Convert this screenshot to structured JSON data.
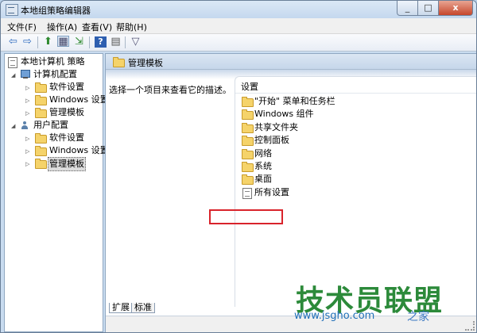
{
  "window": {
    "title": "本地组策略编辑器",
    "minimize": "_",
    "maximize": "□",
    "close": "x"
  },
  "menu": {
    "file": "文件(F)",
    "action": "操作(A)",
    "view": "查看(V)",
    "help": "帮助(H)"
  },
  "toolbar": {
    "icons": [
      "back-arrow",
      "forward-arrow",
      "up-folder",
      "show-tree",
      "export-list",
      "help",
      "properties",
      "filter"
    ],
    "glyphs": {
      "back": "⇦",
      "forward": "⇨",
      "up": "⬆",
      "tree": "▦",
      "export": "⇲",
      "help": "?",
      "props": "▤",
      "filter": "▽"
    }
  },
  "tree": {
    "root": "本地计算机 策略",
    "computer": "计算机配置",
    "computer_software": "软件设置",
    "computer_windows": "Windows 设置",
    "computer_admin": "管理模板",
    "user": "用户配置",
    "user_software": "软件设置",
    "user_windows": "Windows 设置",
    "user_admin": "管理模板",
    "expand_open": "◢",
    "expand_closed": "▷"
  },
  "right": {
    "header": "管理模板",
    "description": "选择一个项目来查看它的描述。",
    "column_header": "设置",
    "items": [
      "\"开始\" 菜单和任务栏",
      "Windows 组件",
      "共享文件夹",
      "控制面板",
      "网络",
      "系统",
      "桌面",
      "所有设置"
    ]
  },
  "tabs": {
    "extended": "扩展",
    "standard": "标准"
  },
  "watermark": {
    "main": "技术员联盟",
    "url": "www.jsgho.com",
    "sub": "之家"
  }
}
